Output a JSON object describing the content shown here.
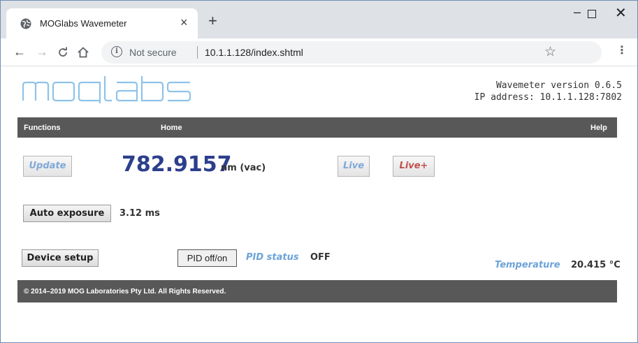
{
  "browser": {
    "tab_title": "MOGlabs Wavemeter",
    "tab_close": "×",
    "new_tab": "+",
    "security_label": "Not secure",
    "url": "10.1.1.128/index.shtml",
    "min_glyph": "–",
    "close_glyph": "✕"
  },
  "header": {
    "logo_text": "moglabs",
    "version": "Wavemeter version 0.6.5",
    "ip": "IP address: 10.1.1.128:7802"
  },
  "menubar": {
    "functions": "Functions",
    "home": "Home",
    "help": "Help"
  },
  "measurement": {
    "update_label": "Update",
    "wavelength": "782.9157",
    "units": "nm (vac)",
    "live_label": "Live",
    "live_plus_label": "Live+"
  },
  "exposure": {
    "button_label": "Auto exposure",
    "value": "3.12 ms"
  },
  "device": {
    "setup_label": "Device setup",
    "pid_button_label": "PID off/on",
    "pid_status_label": "PID status",
    "pid_status_value": "OFF",
    "temperature_label": "Temperature",
    "temperature_value": "20.415 °C"
  },
  "footer": {
    "copyright": "© 2014–2019 MOG Laboratories Pty Ltd. All Rights Reserved."
  },
  "colors": {
    "brand_logo": "#8ec3ea",
    "wavelength_text": "#2c3f8c",
    "label_blue": "#6ca3d8",
    "live_plus_red": "#c0504d",
    "bar_gray": "#585858"
  }
}
